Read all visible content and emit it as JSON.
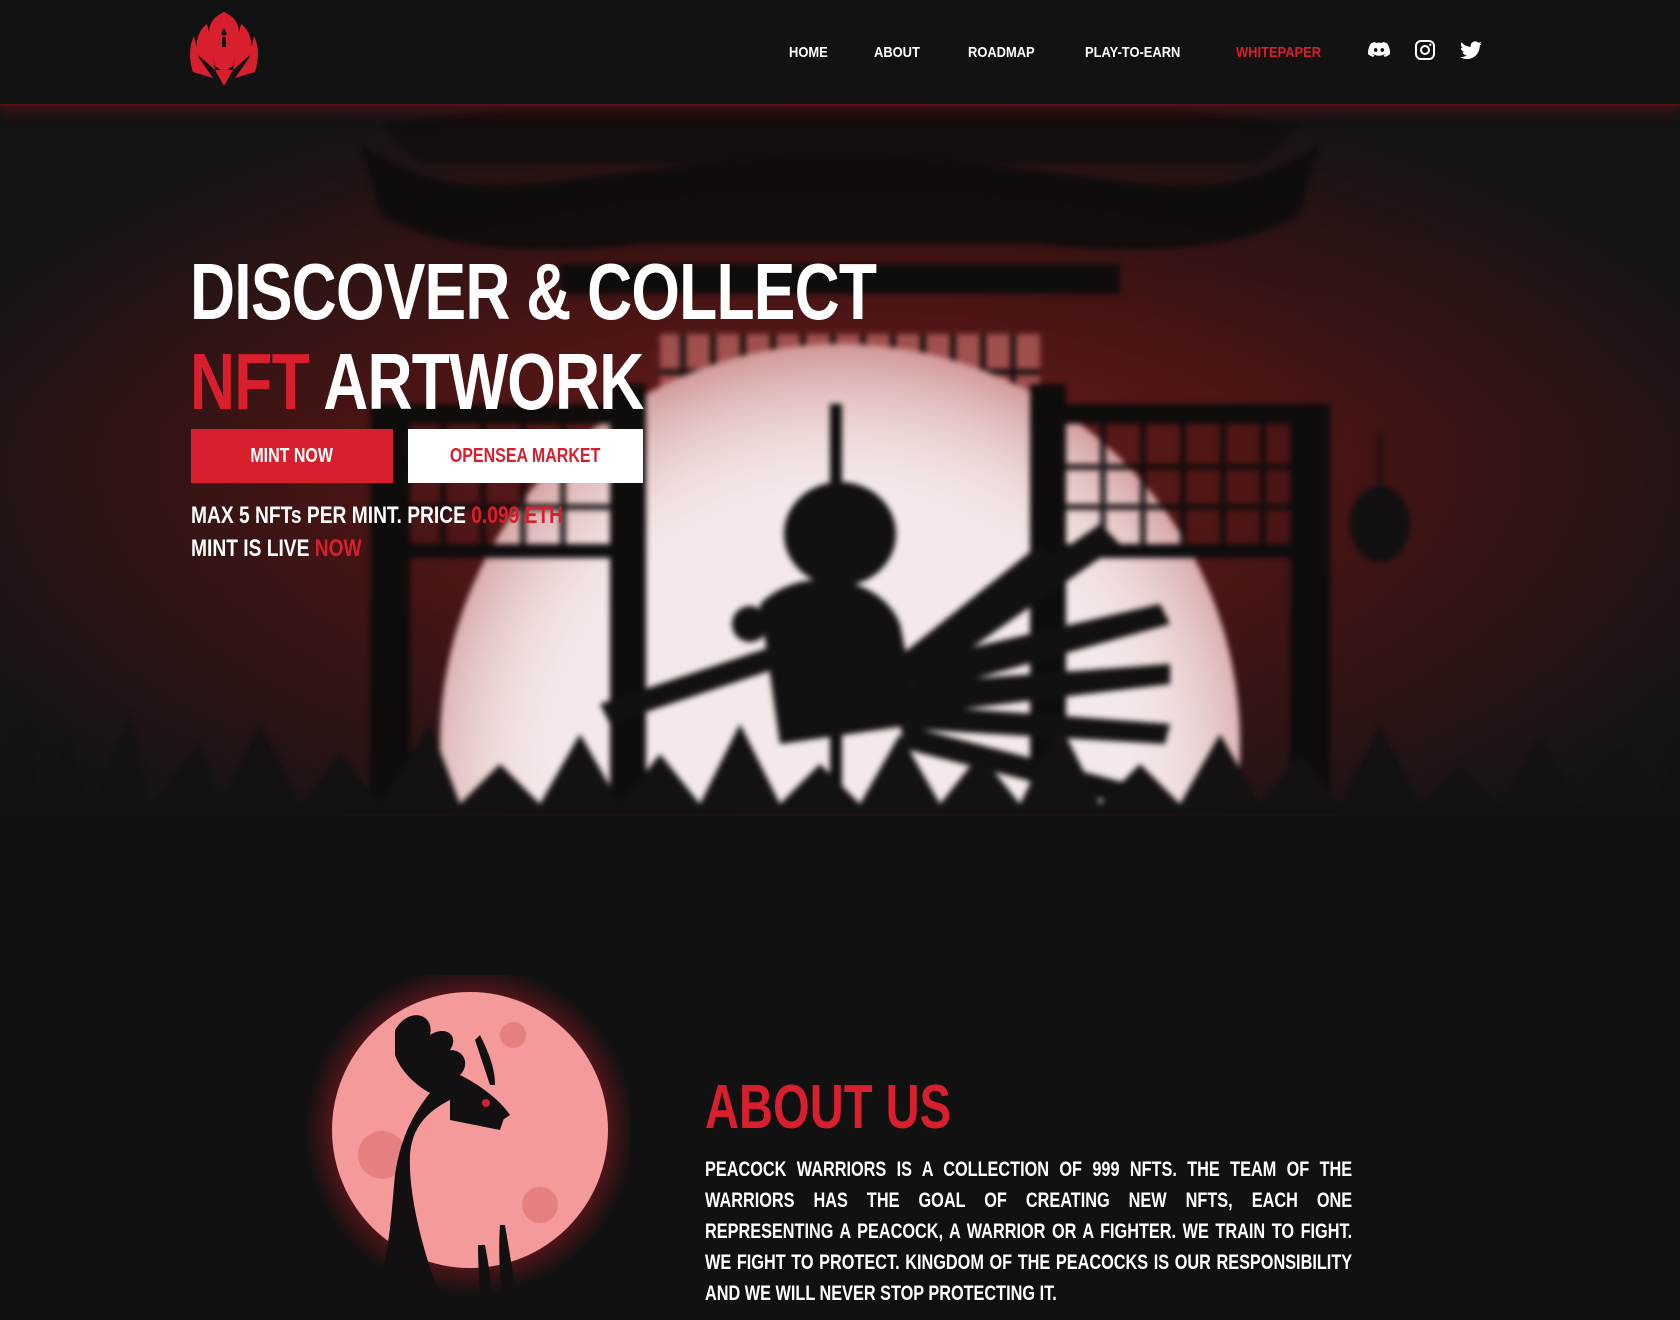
{
  "nav": {
    "items": [
      {
        "label": "HOME"
      },
      {
        "label": "ABOUT"
      },
      {
        "label": "ROADMAP"
      },
      {
        "label": "PLAY-TO-EARN"
      },
      {
        "label": "WHITEPAPER",
        "active": true
      }
    ],
    "social": [
      "discord-icon",
      "instagram-icon",
      "twitter-icon"
    ]
  },
  "hero": {
    "title_line1": "DISCOVER & COLLECT",
    "title_line2_accent": "NFT",
    "title_line2_rest": " ARTWORK",
    "mint_button": "MINT NOW",
    "opensea_button": "OPENSEA MARKET",
    "info_line1_prefix": "MAX 5 NFTs PER MINT. PRICE ",
    "info_line1_price": "0.099 ETH",
    "info_line2_prefix": "MINT IS LIVE ",
    "info_line2_accent": "NOW"
  },
  "about": {
    "title": "ABOUT US",
    "text": "PEACOCK WARRIORS IS A COLLECTION OF 999 NFTS. THE TEAM OF THE WARRIORS HAS THE GOAL OF CREATING NEW NFTS, EACH ONE REPRESENTING A PEACOCK, A WARRIOR OR A FIGHTER. WE TRAIN TO FIGHT. WE FIGHT TO PROTECT. KINGDOM OF THE PEACOCKS IS OUR RESPONSIBILITY AND WE WILL NEVER STOP PROTECTING IT."
  },
  "colors": {
    "accent": "#d81f2d",
    "background": "#111111",
    "moon": "#f59a9a"
  }
}
